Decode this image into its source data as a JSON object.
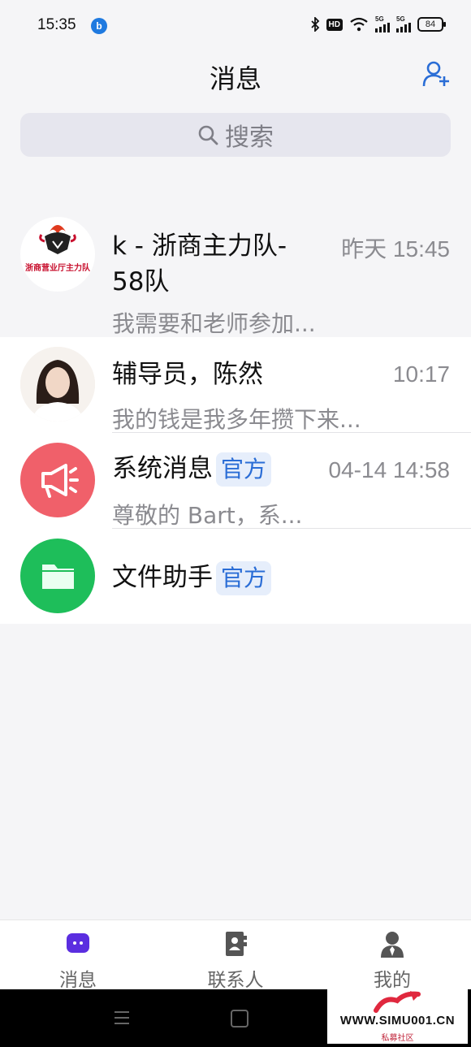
{
  "status": {
    "time": "15:35",
    "app_badge": "b",
    "hd": "HD",
    "sig1": "5G",
    "sig2": "5G",
    "battery": "84"
  },
  "header": {
    "title": "消息"
  },
  "search": {
    "placeholder": "搜索"
  },
  "chats": [
    {
      "name_line1": "k - 浙商主力队-",
      "name_line2": "58队",
      "time": "昨天 15:45",
      "preview": "我需要和老师参加...",
      "avatar_caption": "浙商营业厅主力队"
    },
    {
      "name": "辅导员，陈然",
      "time": "10:17",
      "preview": "我的钱是我多年攒下来..."
    },
    {
      "name": "系统消息",
      "badge": "官方",
      "time": "04-14 14:58",
      "preview": "尊敬的 Bart，系..."
    },
    {
      "name": "文件助手",
      "badge": "官方"
    }
  ],
  "nav": [
    {
      "label": "消息"
    },
    {
      "label": "联系人"
    },
    {
      "label": "我的"
    }
  ],
  "watermark": {
    "text": "WWW.SIMU001.CN",
    "sub": "私募社区"
  },
  "colors": {
    "accent": "#5b2ee0",
    "link_blue": "#2a6dd6",
    "red": "#f0606a",
    "green": "#1ebe5a"
  }
}
